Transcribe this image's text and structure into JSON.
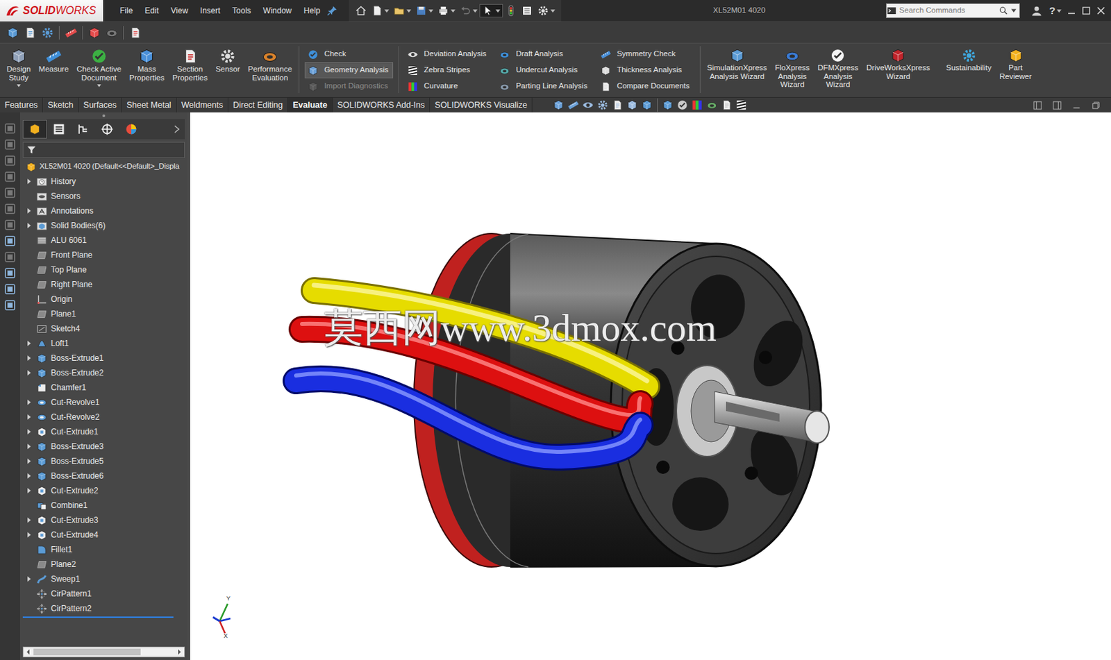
{
  "window": {
    "title": "XL52M01 4020"
  },
  "app": {
    "logo": [
      "SOLID",
      "WORKS"
    ]
  },
  "menu": [
    "File",
    "Edit",
    "View",
    "Insert",
    "Tools",
    "Window",
    "Help"
  ],
  "search": {
    "placeholder": "Search Commands"
  },
  "help": "?",
  "ribbon": {
    "large": [
      {
        "lines": [
          "Design",
          "Study"
        ],
        "dropdown": true
      },
      {
        "lines": [
          "Measure"
        ],
        "dropdown": false
      },
      {
        "lines": [
          "Check Active",
          "Document"
        ],
        "dropdown": true
      },
      {
        "lines": [
          "Mass",
          "Properties"
        ],
        "dropdown": false
      },
      {
        "lines": [
          "Section",
          "Properties"
        ],
        "dropdown": false
      },
      {
        "lines": [
          "Sensor"
        ],
        "dropdown": false
      },
      {
        "lines": [
          "Performance",
          "Evaluation"
        ],
        "dropdown": false
      }
    ],
    "columns": [
      [
        {
          "label": "Check",
          "selected": false,
          "disabled": false
        },
        {
          "label": "Geometry Analysis",
          "selected": true,
          "disabled": false
        },
        {
          "label": "Import Diagnostics",
          "selected": false,
          "disabled": true
        }
      ],
      [
        {
          "label": "Deviation Analysis",
          "selected": false,
          "disabled": false
        },
        {
          "label": "Zebra Stripes",
          "selected": false,
          "disabled": false
        },
        {
          "label": "Curvature",
          "selected": false,
          "disabled": false
        }
      ],
      [
        {
          "label": "Draft Analysis",
          "selected": false,
          "disabled": false
        },
        {
          "label": "Undercut Analysis",
          "selected": false,
          "disabled": false
        },
        {
          "label": "Parting Line Analysis",
          "selected": false,
          "disabled": false
        }
      ],
      [
        {
          "label": "Symmetry Check",
          "selected": false,
          "disabled": false
        },
        {
          "label": "Thickness Analysis",
          "selected": false,
          "disabled": false
        },
        {
          "label": "Compare Documents",
          "selected": false,
          "disabled": false
        }
      ]
    ],
    "wizards": [
      {
        "lines": [
          "SimulationXpress",
          "Analysis Wizard"
        ]
      },
      {
        "lines": [
          "FloXpress",
          "Analysis",
          "Wizard"
        ]
      },
      {
        "lines": [
          "DFMXpress",
          "Analysis",
          "Wizard"
        ]
      },
      {
        "lines": [
          "DriveWorksXpress",
          "Wizard"
        ]
      },
      {
        "lines": [
          "Sustainability"
        ]
      },
      {
        "lines": [
          "Part",
          "Reviewer"
        ]
      }
    ]
  },
  "tabs": [
    {
      "label": "Features",
      "selected": false
    },
    {
      "label": "Sketch",
      "selected": false
    },
    {
      "label": "Surfaces",
      "selected": false
    },
    {
      "label": "Sheet Metal",
      "selected": false
    },
    {
      "label": "Weldments",
      "selected": false
    },
    {
      "label": "Direct Editing",
      "selected": false
    },
    {
      "label": "Evaluate",
      "selected": true
    },
    {
      "label": "SOLIDWORKS Add-Ins",
      "selected": false
    },
    {
      "label": "SOLIDWORKS Visualize",
      "selected": false
    }
  ],
  "panel_tabs": [
    {
      "selected": true
    },
    {
      "selected": false
    },
    {
      "selected": false
    },
    {
      "selected": false
    },
    {
      "selected": false
    }
  ],
  "tree": {
    "root": "XL52M01 4020 (Default<<Default>_Displa",
    "items": [
      {
        "name": "History",
        "kind": "history",
        "expandable": true
      },
      {
        "name": "Sensors",
        "kind": "sensors",
        "expandable": false
      },
      {
        "name": "Annotations",
        "kind": "annotations",
        "expandable": true
      },
      {
        "name": "Solid Bodies(6)",
        "kind": "bodies",
        "expandable": true
      },
      {
        "name": "ALU 6061",
        "kind": "material",
        "expandable": false
      },
      {
        "name": "Front Plane",
        "kind": "plane",
        "expandable": false
      },
      {
        "name": "Top Plane",
        "kind": "plane",
        "expandable": false
      },
      {
        "name": "Right Plane",
        "kind": "plane",
        "expandable": false
      },
      {
        "name": "Origin",
        "kind": "origin",
        "expandable": false
      },
      {
        "name": "Plane1",
        "kind": "plane",
        "expandable": false
      },
      {
        "name": "Sketch4",
        "kind": "sketch",
        "expandable": false
      },
      {
        "name": "Loft1",
        "kind": "loft",
        "expandable": true
      },
      {
        "name": "Boss-Extrude1",
        "kind": "extrude",
        "expandable": true
      },
      {
        "name": "Boss-Extrude2",
        "kind": "extrude",
        "expandable": true
      },
      {
        "name": "Chamfer1",
        "kind": "chamfer",
        "expandable": false
      },
      {
        "name": "Cut-Revolve1",
        "kind": "revolve",
        "expandable": true
      },
      {
        "name": "Cut-Revolve2",
        "kind": "revolve",
        "expandable": true
      },
      {
        "name": "Cut-Extrude1",
        "kind": "cut",
        "expandable": true
      },
      {
        "name": "Boss-Extrude3",
        "kind": "extrude",
        "expandable": true
      },
      {
        "name": "Boss-Extrude5",
        "kind": "extrude",
        "expandable": true
      },
      {
        "name": "Boss-Extrude6",
        "kind": "extrude",
        "expandable": true
      },
      {
        "name": "Cut-Extrude2",
        "kind": "cut",
        "expandable": true
      },
      {
        "name": "Combine1",
        "kind": "combine",
        "expandable": false
      },
      {
        "name": "Cut-Extrude3",
        "kind": "cut",
        "expandable": true
      },
      {
        "name": "Cut-Extrude4",
        "kind": "cut",
        "expandable": true
      },
      {
        "name": "Fillet1",
        "kind": "fillet",
        "expandable": false
      },
      {
        "name": "Plane2",
        "kind": "plane",
        "expandable": false
      },
      {
        "name": "Sweep1",
        "kind": "sweep",
        "expandable": true
      },
      {
        "name": "CirPattern1",
        "kind": "pattern",
        "expandable": false
      },
      {
        "name": "CirPattern2",
        "kind": "pattern",
        "expandable": false
      }
    ]
  },
  "graphics": {
    "watermark": "莫西网www.3dmox.com",
    "triad": [
      "Y",
      "X"
    ]
  }
}
